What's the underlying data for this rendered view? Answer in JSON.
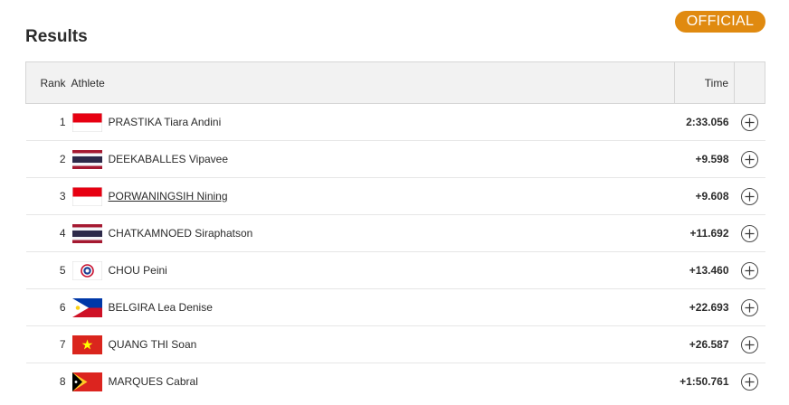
{
  "header": {
    "title": "Results",
    "status_badge": "OFFICIAL"
  },
  "colors": {
    "badge": "#e08a10",
    "header_bg": "#f2f2f2"
  },
  "table": {
    "columns": {
      "rank": "Rank",
      "athlete": "Athlete",
      "time": "Time"
    },
    "rows": [
      {
        "rank": "1",
        "athlete": "PRASTIKA Tiara Andini",
        "flag": "indonesia-flag",
        "time": "2:33.056"
      },
      {
        "rank": "2",
        "athlete": "DEEKABALLES Vipavee",
        "flag": "thailand-flag",
        "time": "+9.598"
      },
      {
        "rank": "3",
        "athlete": "PORWANINGSIH Nining",
        "flag": "indonesia-flag",
        "time": "+9.608"
      },
      {
        "rank": "4",
        "athlete": "CHATKAMNOED Siraphatson",
        "flag": "thailand-flag",
        "time": "+11.692"
      },
      {
        "rank": "5",
        "athlete": "CHOU Peini",
        "flag": "chinese-taipei-flag",
        "time": "+13.460"
      },
      {
        "rank": "6",
        "athlete": "BELGIRA Lea Denise",
        "flag": "philippines-flag",
        "time": "+22.693"
      },
      {
        "rank": "7",
        "athlete": "QUANG THI Soan",
        "flag": "vietnam-flag",
        "time": "+26.587"
      },
      {
        "rank": "8",
        "athlete": "MARQUES Cabral",
        "flag": "timor-leste-flag",
        "time": "+1:50.761"
      }
    ]
  },
  "icons": {
    "expand": "plus-circle-icon"
  }
}
